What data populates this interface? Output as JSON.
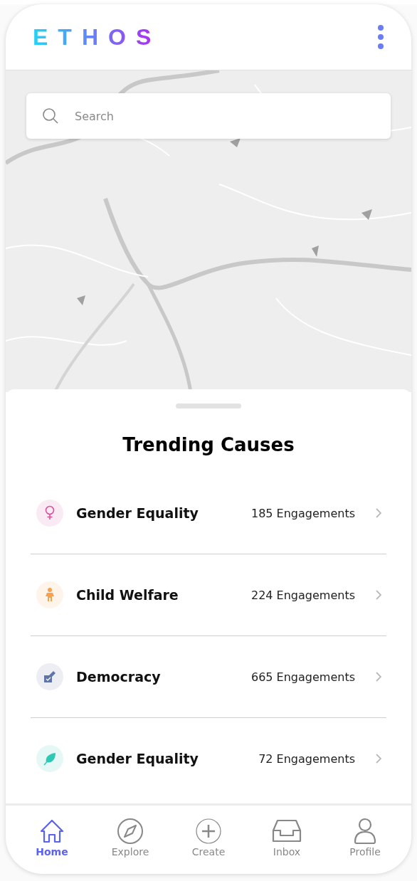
{
  "header": {
    "logo": "ETHOS"
  },
  "search": {
    "placeholder": "Search"
  },
  "trending": {
    "title": "Trending Causes",
    "causes": [
      {
        "name": "Gender Equality",
        "engagements": "185 Engagements",
        "kind": "female",
        "color": "#d9539b"
      },
      {
        "name": "Child Welfare",
        "engagements": "224 Engagements",
        "kind": "child",
        "color": "#f7a14f"
      },
      {
        "name": "Democracy",
        "engagements": "665 Engagements",
        "kind": "vote",
        "color": "#5f74a8"
      },
      {
        "name": "Gender Equality",
        "engagements": "72 Engagements",
        "kind": "leaf",
        "color": "#2ec9b4"
      }
    ]
  },
  "nav": [
    {
      "label": "Home",
      "kind": "home",
      "selected": true
    },
    {
      "label": "Explore",
      "kind": "compass",
      "selected": false
    },
    {
      "label": "Create",
      "kind": "plus",
      "selected": false
    },
    {
      "label": "Inbox",
      "kind": "inbox",
      "selected": false
    },
    {
      "label": "Profile",
      "kind": "person",
      "selected": false
    }
  ]
}
